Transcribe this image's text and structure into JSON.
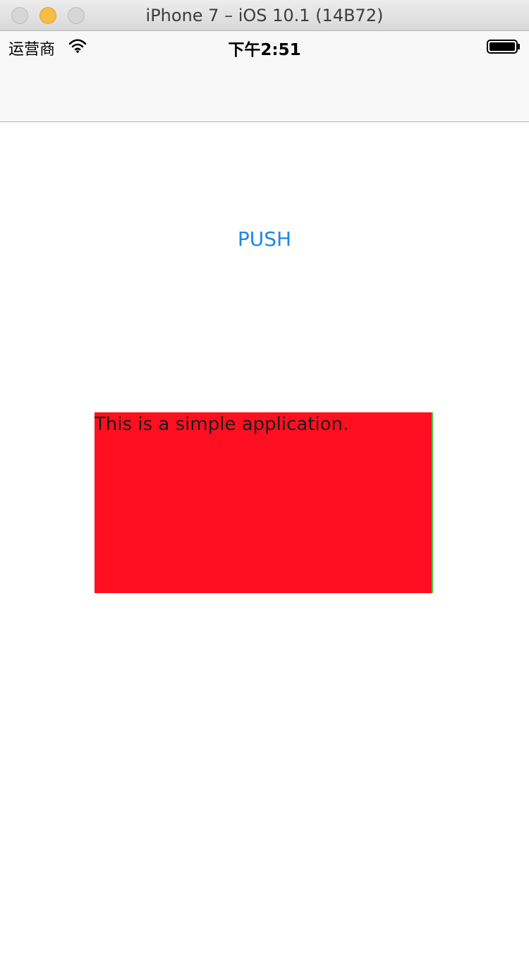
{
  "window": {
    "title": "iPhone 7 – iOS 10.1 (14B72)"
  },
  "status_bar": {
    "carrier": "运营商",
    "time": "下午2:51",
    "wifi_icon": "wifi-icon",
    "battery_icon": "battery-icon"
  },
  "main": {
    "push_button_label": "PUSH",
    "panel_text": "This is a simple application."
  },
  "colors": {
    "push_button": "#1e88e5",
    "panel_background": "#ff0f1f",
    "panel_border": "#49cc49",
    "navbar_background": "#f8f8f8"
  }
}
